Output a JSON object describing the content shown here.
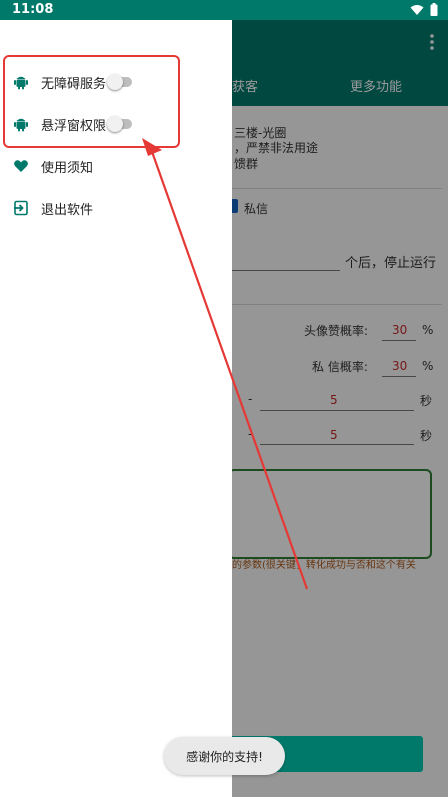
{
  "status_bar": {
    "time": "11:08"
  },
  "background_app": {
    "tabs": [
      "获客",
      "更多功能"
    ],
    "notice_lines": [
      "三楼-光圈",
      "，严禁非法用途",
      "馈群"
    ],
    "private_message_checkbox_label": "私信",
    "stop_suffix": "个后，停止运行",
    "avatar_like_rate": {
      "label": "头像赞概率:",
      "value": "30",
      "unit": "%"
    },
    "private_msg_rate": {
      "label": "私 信概率:",
      "value": "30",
      "unit": "%"
    },
    "interval_rows": [
      {
        "dash": "-",
        "value": "5",
        "unit": "秒"
      },
      {
        "dash": "-",
        "value": "5",
        "unit": "秒"
      }
    ],
    "hint_text": "的参数(很关键，转化成功与否和这个有关"
  },
  "drawer": {
    "items": [
      {
        "label": "无障碍服务",
        "icon": "android-icon",
        "toggle": false
      },
      {
        "label": "悬浮窗权限",
        "icon": "android-icon",
        "toggle": false
      },
      {
        "label": "使用须知",
        "icon": "heart-icon"
      },
      {
        "label": "退出软件",
        "icon": "exit-icon"
      }
    ]
  },
  "toast": {
    "text": "感谢你的支持!"
  },
  "colors": {
    "primary": "#00796b",
    "accent_red": "#e53935",
    "annotation_red": "#e53935"
  }
}
